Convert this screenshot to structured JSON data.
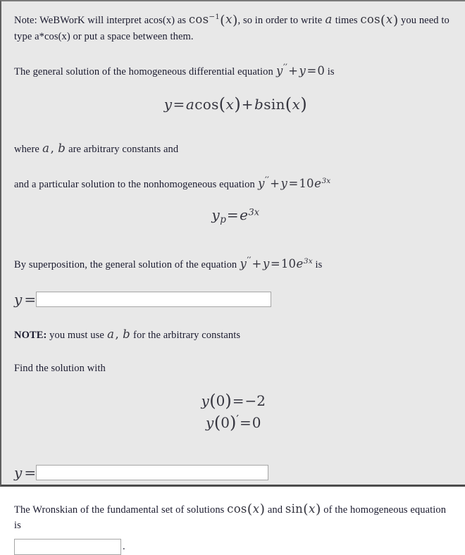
{
  "page": {
    "background_color": "#e8e8e8",
    "input_background_color": "#ffffff",
    "input_border_color": "#a6a6a6",
    "text_color": "#1a1a2e",
    "math_color": "#35353f"
  },
  "note_line": {
    "prefix": "Note: WeBWorK will interpret acos(x) as ",
    "math_acos": "cos",
    "math_acos_exponent": "−1",
    "math_acos_arg": "x",
    "middle": ", so in order to write ",
    "math_a": "a",
    "middle2": " times ",
    "math_cos": "cos",
    "math_cos_arg": "x",
    "suffix": " you need to type a*cos(x) or put a space between them."
  },
  "general_solution_intro": {
    "prefix": "The general solution of the homogeneous differential equation ",
    "math_y": "y",
    "math_prime": "′′",
    "math_plus": "+",
    "math_y2": "y",
    "math_equals": "=",
    "math_zero": "0",
    "suffix": " is"
  },
  "general_solution_equation": {
    "lhs": "y",
    "equals": "=",
    "coef_a": "a",
    "cos": "cos",
    "cos_arg": "x",
    "plus": "+",
    "coef_b": "b",
    "sin": "sin",
    "sin_arg": "x"
  },
  "constants_line": {
    "prefix": "where ",
    "a": "a",
    "comma": ",",
    "b": "b",
    "suffix": " are arbitrary constants and"
  },
  "particular_intro": {
    "prefix": "and a particular solution to the nonhomogeneous equation ",
    "y": "y",
    "prime": "′′",
    "plus": "+",
    "y2": "y",
    "equals": "=",
    "ten": "10",
    "e": "e",
    "exponent": "3x"
  },
  "particular_equation": {
    "lhs_y": "y",
    "lhs_sub": "p",
    "equals": "=",
    "e": "e",
    "exponent": "3x"
  },
  "superposition_intro": {
    "prefix": "By superposition, the general solution of the equation ",
    "y": "y",
    "prime": "′′",
    "plus": "+",
    "y2": "y",
    "equals": "=",
    "ten": "10",
    "e": "e",
    "exponent": "3x",
    "suffix": " is"
  },
  "answer_general": {
    "label_y": "y",
    "label_equals": "=",
    "value": "",
    "placeholder": ""
  },
  "note_constants": {
    "bold_prefix": "NOTE:",
    "text_1": " you must use ",
    "a": "a",
    "comma": ",",
    "b": "b",
    "text_2": " for the arbitrary constants"
  },
  "find_solution_heading": "Find the solution with",
  "initial_conditions": [
    {
      "y": "y",
      "open": "(",
      "arg": "0",
      "close": ")",
      "prime": "",
      "equals": "=",
      "value": "−2"
    },
    {
      "y": "y",
      "open": "(",
      "arg": "0",
      "close": ")",
      "prime": "′",
      "equals": "=",
      "value": "0"
    }
  ],
  "answer_ivp": {
    "label_y": "y",
    "label_equals": "=",
    "value": "",
    "placeholder": ""
  },
  "wronskian_line": {
    "prefix": "The Wronskian of the fundamental set of solutions ",
    "cos": "cos",
    "cos_arg": "x",
    "and": " and ",
    "sin": "sin",
    "sin_arg": "x",
    "suffix": " of the homogeneous equation is"
  },
  "answer_wronskian": {
    "value": "",
    "placeholder": "",
    "trailing_punctuation": "."
  }
}
